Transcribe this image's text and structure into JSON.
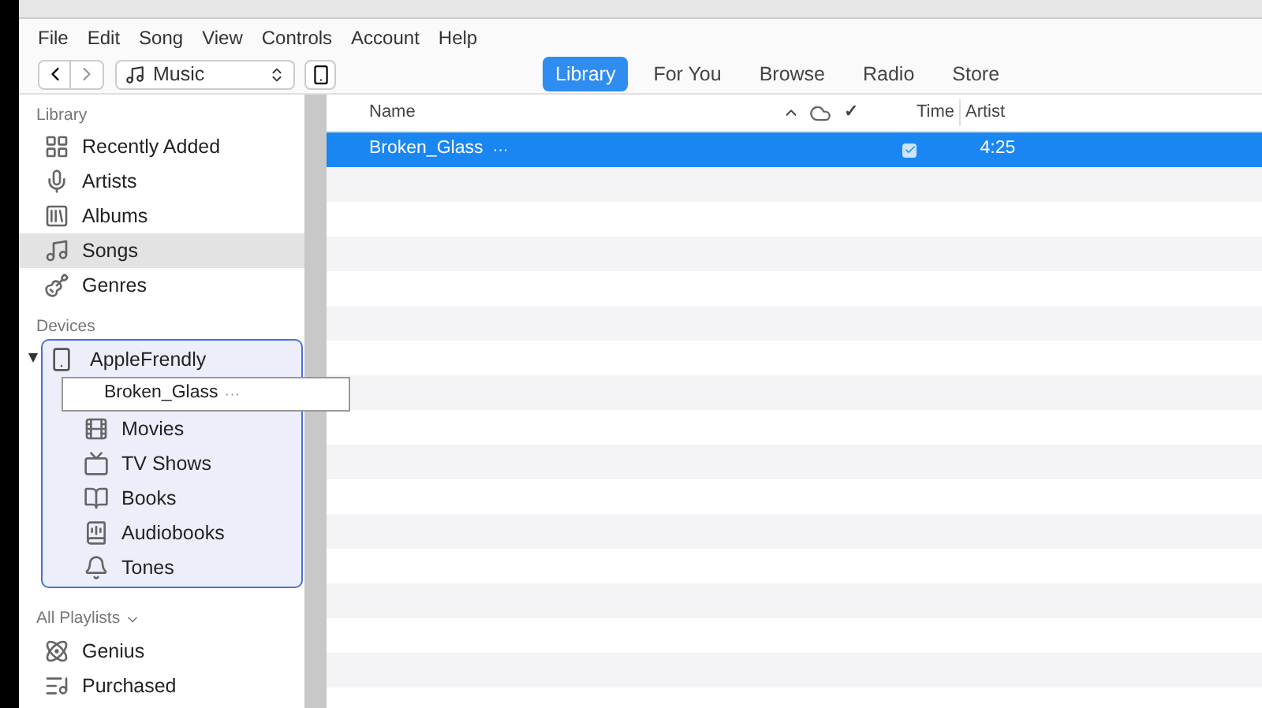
{
  "menu": [
    "File",
    "Edit",
    "Song",
    "View",
    "Controls",
    "Account",
    "Help"
  ],
  "toolbar": {
    "media_kind": "Music",
    "tabs": [
      {
        "label": "Library",
        "selected": true
      },
      {
        "label": "For You",
        "selected": false
      },
      {
        "label": "Browse",
        "selected": false
      },
      {
        "label": "Radio",
        "selected": false
      },
      {
        "label": "Store",
        "selected": false
      }
    ]
  },
  "sidebar": {
    "library": {
      "title": "Library",
      "items": [
        {
          "label": "Recently Added",
          "selected": false
        },
        {
          "label": "Artists",
          "selected": false
        },
        {
          "label": "Albums",
          "selected": false
        },
        {
          "label": "Songs",
          "selected": true
        },
        {
          "label": "Genres",
          "selected": false
        }
      ]
    },
    "devices": {
      "title": "Devices",
      "device": {
        "name": "AppleFrendly",
        "expanded": true,
        "drag_ghost": {
          "title": "Broken_Glass",
          "more": "···"
        },
        "children": [
          {
            "label": "Movies"
          },
          {
            "label": "TV Shows"
          },
          {
            "label": "Books"
          },
          {
            "label": "Audiobooks"
          },
          {
            "label": "Tones"
          }
        ]
      }
    },
    "playlists": {
      "title": "All Playlists",
      "items": [
        {
          "label": "Genius"
        },
        {
          "label": "Purchased"
        }
      ]
    }
  },
  "table": {
    "columns": {
      "name": "Name",
      "check": "✓",
      "time": "Time",
      "artist": "Artist"
    },
    "rows": [
      {
        "name": "Broken_Glass",
        "more": "···",
        "checked": true,
        "time": "4:25",
        "selected": true
      }
    ]
  }
}
